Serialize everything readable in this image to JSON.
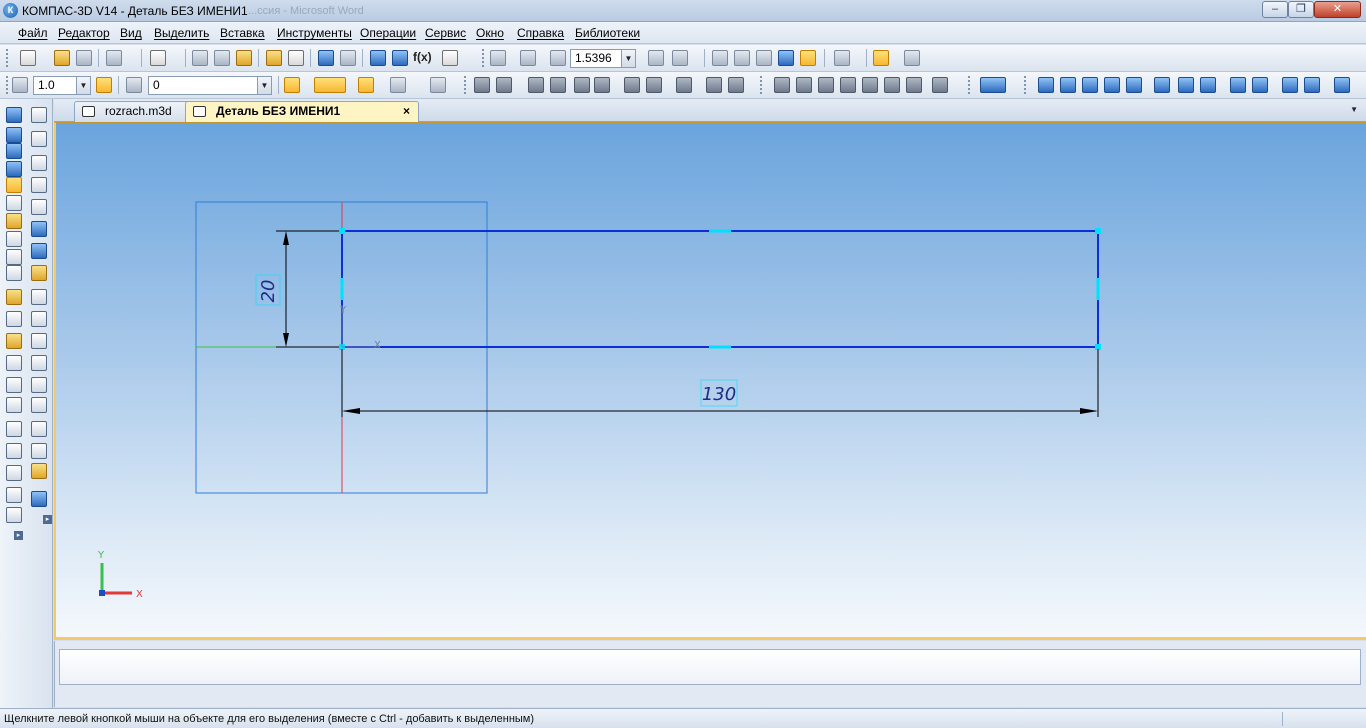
{
  "window": {
    "title": "КОМПАС-3D V14 - Деталь БЕЗ ИМЕНИ1",
    "app_icon_letter": "К",
    "background_title": "...ссия - Microsoft Word"
  },
  "menu": {
    "items": [
      "Файл",
      "Редактор",
      "Вид",
      "Выделить",
      "Вставка",
      "Инструменты",
      "Операции",
      "Сервис",
      "Окно",
      "Справка",
      "Библиотеки"
    ]
  },
  "toolbar_standard": {
    "zoom_value": "1.5396",
    "fx_label": "f(x)"
  },
  "toolbar_current_state": {
    "step_value": "1.0",
    "layer_value": "0"
  },
  "tabs": [
    {
      "label": "rozrach.m3d"
    },
    {
      "label": "Деталь БЕЗ ИМЕНИ1",
      "close": "×"
    }
  ],
  "sketch": {
    "dim_height": "20",
    "dim_length": "130",
    "axis_x": "X",
    "axis_y": "Y"
  },
  "triad": {
    "x": "X",
    "y": "Y"
  },
  "colors": {
    "sketch_line": "#0b2fd6",
    "sketch_point": "#00e1ff",
    "selection_frame": "#2e7fd8",
    "axis_red": "#e03a3a",
    "axis_green": "#39c04a",
    "dim_text": "#1d2a86",
    "active_tab": "#fff4c4"
  },
  "status": {
    "text": "Щелкните левой кнопкой мыши на объекте для его выделения (вместе с Ctrl - добавить к выделенным)"
  }
}
